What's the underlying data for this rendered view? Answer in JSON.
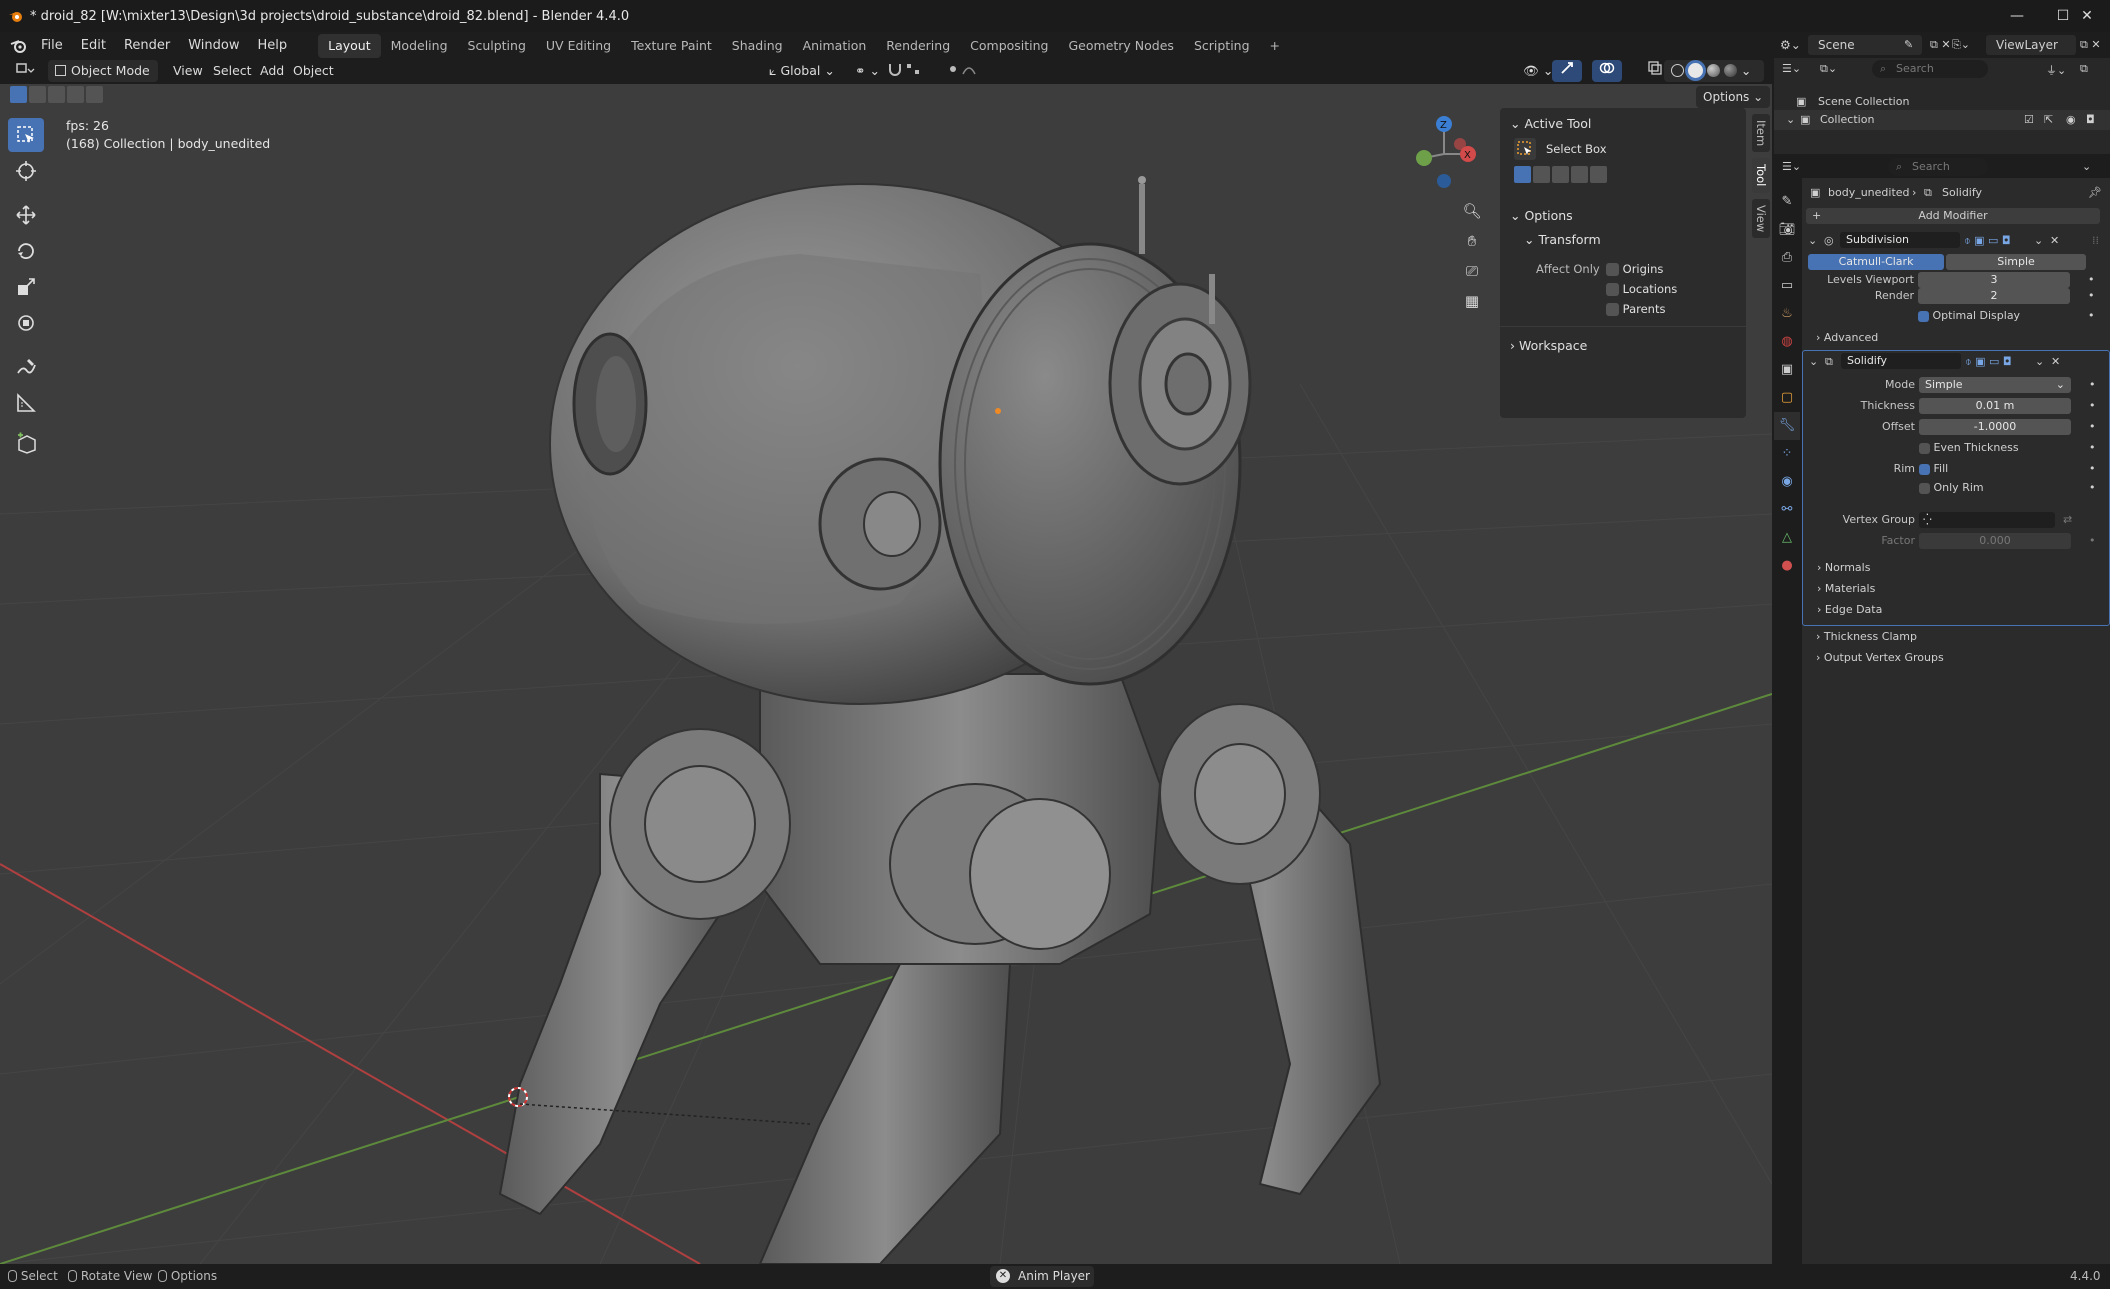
{
  "window": {
    "title": "* droid_82 [W:\\mixter13\\Design\\3d projects\\droid_substance\\droid_82.blend] - Blender 4.4.0",
    "minimize": "—",
    "maximize": "☐",
    "close": "✕"
  },
  "menus": [
    "File",
    "Edit",
    "Render",
    "Window",
    "Help"
  ],
  "workspaces": [
    "Layout",
    "Modeling",
    "Sculpting",
    "UV Editing",
    "Texture Paint",
    "Shading",
    "Animation",
    "Rendering",
    "Compositing",
    "Geometry Nodes",
    "Scripting"
  ],
  "workspace_add": "+",
  "scene": {
    "label": "Scene",
    "viewlayer": "ViewLayer"
  },
  "header": {
    "mode": "Object Mode",
    "view": "View",
    "select": "Select",
    "add": "Add",
    "object": "Object",
    "orientation": "Global",
    "options": "Options"
  },
  "viewport": {
    "fps": "fps: 26",
    "collection_info": "(168) Collection | body_unedited",
    "axis_x": "X",
    "axis_y": "Y",
    "axis_z": "Z"
  },
  "npanel": {
    "active_tool": "Active Tool",
    "tool_name": "Select Box",
    "options": "Options",
    "transform": "Transform",
    "affect_only": "Affect Only",
    "origins": "Origins",
    "locations": "Locations",
    "parents": "Parents",
    "workspace": "Workspace",
    "tabs": [
      "Item",
      "Tool",
      "View"
    ]
  },
  "outliner": {
    "search_placeholder": "Search",
    "scene_collection": "Scene Collection",
    "collection": "Collection"
  },
  "properties": {
    "search_placeholder": "Search",
    "object": "body_unedited",
    "modifier_path": "Solidify",
    "add_modifier": "Add Modifier",
    "subdivision": {
      "name": "Subdivision",
      "catmull": "Catmull-Clark",
      "simple": "Simple",
      "levels_viewport_label": "Levels Viewport",
      "levels_viewport": "3",
      "render_label": "Render",
      "render": "2",
      "optimal_display": "Optimal Display",
      "advanced": "Advanced"
    },
    "solidify": {
      "name": "Solidify",
      "mode_label": "Mode",
      "mode": "Simple",
      "thickness_label": "Thickness",
      "thickness": "0.01 m",
      "offset_label": "Offset",
      "offset": "-1.0000",
      "even_thickness": "Even Thickness",
      "rim_label": "Rim",
      "fill": "Fill",
      "only_rim": "Only Rim",
      "vertex_group_label": "Vertex Group",
      "factor_label": "Factor",
      "factor": "0.000"
    },
    "subpanels": [
      "Normals",
      "Materials",
      "Edge Data",
      "Thickness Clamp",
      "Output Vertex Groups"
    ]
  },
  "status": {
    "select": "Select",
    "rotate_view": "Rotate View",
    "options": "Options",
    "anim_player": "Anim Player",
    "version": "4.4.0"
  },
  "colors": {
    "accent": "#4772b3",
    "bg": "#1d1d1d",
    "viewport": "#3d3d3d",
    "panel": "#2c2c2c",
    "x_axis": "#c0392b",
    "y_axis": "#6ea04a"
  }
}
